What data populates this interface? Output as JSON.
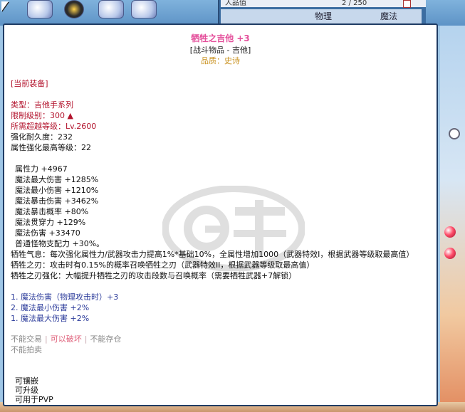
{
  "background": {
    "row1_label": "人品值",
    "row1_value": "2 / 250",
    "tab_physical": "物理",
    "tab_magic": "魔法"
  },
  "tooltip": {
    "item_name": "牺牲之吉他 +3",
    "category": "[战斗物品 - 吉他]",
    "quality": "品质：史诗",
    "current_equipped": "[当前装备]",
    "type": "类型：吉他手系列",
    "level_limit": "限制级别：300 ▲",
    "transcend_level": "所需超越等级：Lv.2600",
    "durability": "强化耐久度：232",
    "max_enhance_level": "属性强化最高等级：22",
    "stats": [
      "属性力 +4967",
      "魔法最大伤害 +1285%",
      "魔法最小伤害 +1210%",
      "魔法暴击伤害 +3462%",
      "魔法暴击概率 +80%",
      "魔法贯穿力 +129%",
      "魔法伤害 +33470",
      "普通怪物支配力 +30%。"
    ],
    "effects": [
      "牺牲气息：每次强化属性力/武器攻击力提高1%*基础10%，全属性增加1000（武器特效I，根据武器等级取最高值）",
      "牺牲之刃：攻击时有0.15%的概率召唤牺牲之刃（武器特效II，根据武器等级取最高值）",
      "牺牲之刃强化：大幅提升牺牲之刃的攻击段数与召唤概率（需要牺牲武器+7解锁）"
    ],
    "enchants": [
      "1. 魔法伤害（物理攻击时）+3",
      "2. 魔法最小伤害 +2%",
      "1. 魔法最大伤害 +2%"
    ],
    "restrict_trade": "不能交易",
    "restrict_break": "可以破坏",
    "restrict_store": "不能存仓",
    "restrict_auction": "不能拍卖",
    "socketable": "可镶嵌",
    "upgradable": "可升级",
    "pvp": "可用于PVP"
  },
  "colors": {
    "title": "#e44f9b",
    "quality": "#c9901c",
    "red_text": "#b3152e",
    "enchant_text": "#2a3a9a",
    "border": "#1f3c64"
  }
}
